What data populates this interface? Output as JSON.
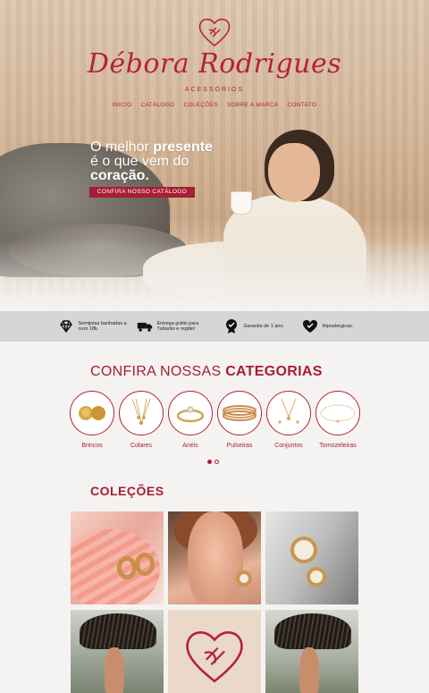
{
  "brand": {
    "name": "Débora Rodrigues",
    "subtitle": "ACESSÓRIOS",
    "color": "#b5213b"
  },
  "nav": {
    "items": [
      {
        "label": "INICIO"
      },
      {
        "label": "CATÁLOGO"
      },
      {
        "label": "COLEÇÕES"
      },
      {
        "label": "SOBRE A MARCA"
      },
      {
        "label": "CONTATO"
      }
    ]
  },
  "hero": {
    "line1_normal": "O melhor ",
    "line1_bold": "presente",
    "line2": "é o que vem do",
    "line3_bold": "coração.",
    "cta_label": "CONFIRA NOSSO CATÁLOGO"
  },
  "benefits": [
    {
      "icon": "diamond-icon",
      "text": "Semijoias banhadas a ouro 18k."
    },
    {
      "icon": "truck-icon",
      "text": "Entrega grátis para Tubarão e região!"
    },
    {
      "icon": "badge-icon",
      "text": "Garantia de 1 ano."
    },
    {
      "icon": "heart-icon",
      "text": "Hipoalergicas."
    }
  ],
  "categories": {
    "title_normal": "CONFIRA NOSSAS ",
    "title_bold": "CATEGORIAS",
    "items": [
      {
        "label": "Brincos"
      },
      {
        "label": "Colares"
      },
      {
        "label": "Anéis"
      },
      {
        "label": "Pulseiras"
      },
      {
        "label": "Conjuntos"
      },
      {
        "label": "Tornozeleiras"
      }
    ],
    "pagination": {
      "pages": 2,
      "current": 1
    }
  },
  "collections": {
    "title": "COLEÇÕES"
  },
  "colors": {
    "accent": "#b5213b",
    "accent_dark": "#a71d34",
    "benefits_bg": "#d7d6d4"
  }
}
